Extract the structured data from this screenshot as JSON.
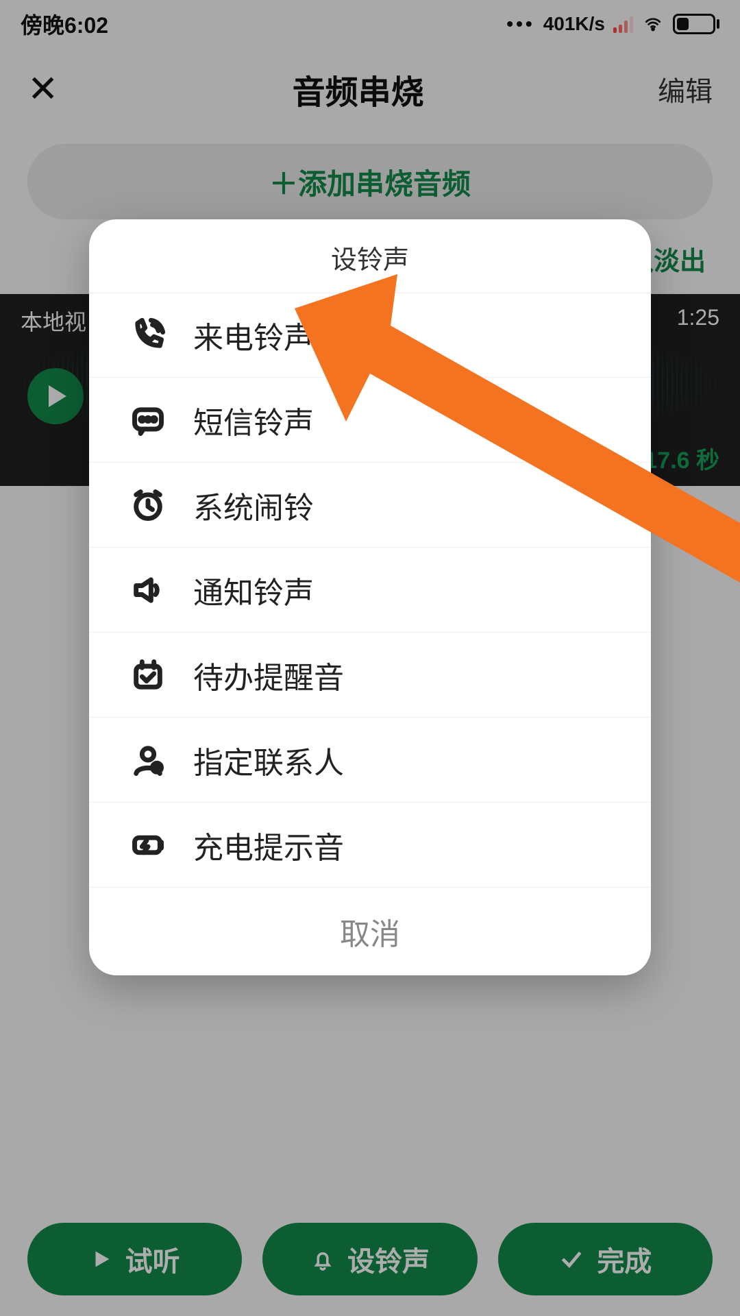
{
  "status": {
    "time": "傍晚6:02",
    "net_speed": "401K/s",
    "battery_pct": "33"
  },
  "nav": {
    "title": "音频串烧",
    "edit": "编辑"
  },
  "add_button": "＋添加串烧音频",
  "fade_toggle": "连播淡入淡出",
  "audio": {
    "name_partial": "本地视",
    "t_start": "1:25",
    "duration_display": "17.6 秒"
  },
  "bottom": {
    "preview": "试听",
    "set_ring": "设铃声",
    "done": "完成"
  },
  "sheet": {
    "title": "设铃声",
    "items": [
      {
        "icon": "phone-icon",
        "label": "来电铃声"
      },
      {
        "icon": "message-icon",
        "label": "短信铃声"
      },
      {
        "icon": "alarm-icon",
        "label": "系统闹铃"
      },
      {
        "icon": "speaker-icon",
        "label": "通知铃声"
      },
      {
        "icon": "todo-icon",
        "label": "待办提醒音"
      },
      {
        "icon": "contact-icon",
        "label": "指定联系人"
      },
      {
        "icon": "charge-icon",
        "label": "充电提示音"
      }
    ],
    "cancel": "取消"
  }
}
